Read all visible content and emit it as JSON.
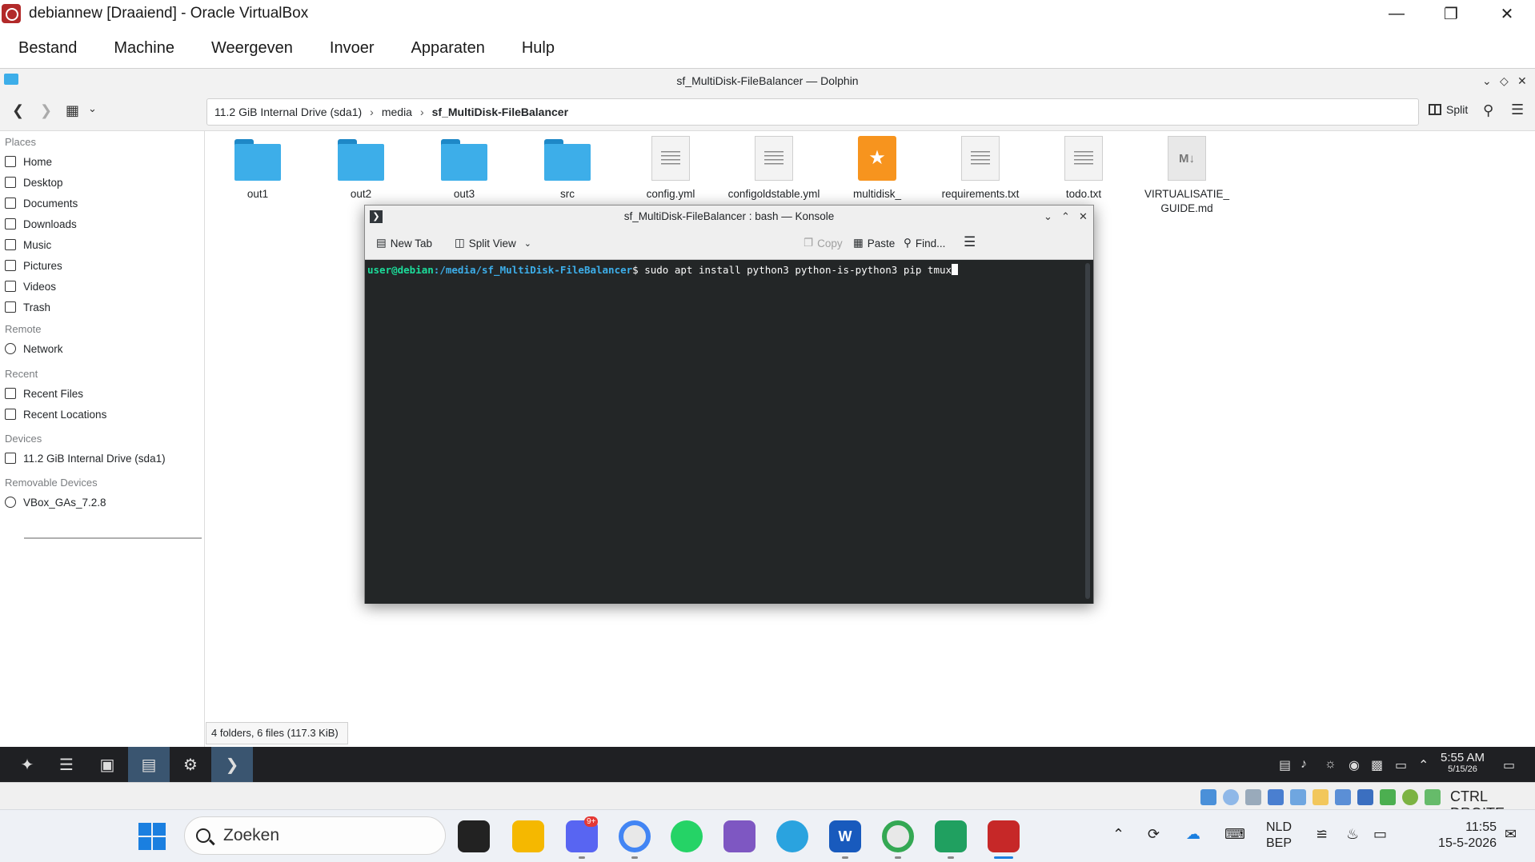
{
  "vbox": {
    "title": "debiannew [Draaiend] - Oracle VirtualBox",
    "menu": [
      "Bestand",
      "Machine",
      "Weergeven",
      "Invoer",
      "Apparaten",
      "Hulp"
    ],
    "host_key": "CTRL DROITE"
  },
  "dolphin": {
    "title": "sf_MultiDisk-FileBalancer — Dolphin",
    "breadcrumb": [
      "11.2 GiB Internal Drive (sda1)",
      "media",
      "sf_MultiDisk-FileBalancer"
    ],
    "split_label": "Split",
    "sidebar": {
      "places_header": "Places",
      "places": [
        "Home",
        "Desktop",
        "Documents",
        "Downloads",
        "Music",
        "Pictures",
        "Videos",
        "Trash"
      ],
      "remote_header": "Remote",
      "remote": [
        "Network"
      ],
      "recent_header": "Recent",
      "recent": [
        "Recent Files",
        "Recent Locations"
      ],
      "devices_header": "Devices",
      "devices": [
        "11.2 GiB Internal Drive (sda1)"
      ],
      "removable_header": "Removable Devices",
      "removable": [
        "VBox_GAs_7.2.8"
      ]
    },
    "files": [
      {
        "name": "out1",
        "kind": "folder"
      },
      {
        "name": "out2",
        "kind": "folder"
      },
      {
        "name": "out3",
        "kind": "folder"
      },
      {
        "name": "src",
        "kind": "folder"
      },
      {
        "name": "config.yml",
        "kind": "text"
      },
      {
        "name": "configoldstable.yml",
        "kind": "text"
      },
      {
        "name": "multidisk_",
        "kind": "python"
      },
      {
        "name": "requirements.txt",
        "kind": "text"
      },
      {
        "name": "todo.txt",
        "kind": "text"
      },
      {
        "name": "VIRTUALISATIE_\nGUIDE.md",
        "kind": "markdown"
      }
    ],
    "status": "4 folders, 6 files (117.3 KiB)"
  },
  "konsole": {
    "title": "sf_MultiDisk-FileBalancer : bash — Konsole",
    "toolbar": {
      "new_tab": "New Tab",
      "split_view": "Split View",
      "copy": "Copy",
      "paste": "Paste",
      "find": "Find..."
    },
    "prompt_user": "user@debian",
    "prompt_path": ":/media/sf_MultiDisk-FileBalancer",
    "prompt_symbol": "$",
    "command": " sudo apt install python3 python-is-python3 pip tmux"
  },
  "guest_panel": {
    "time": "5:55 AM",
    "date": "5/15/26"
  },
  "windows": {
    "search_placeholder": "Zoeken",
    "discord_badge": "9+",
    "lang_top": "NLD",
    "lang_bottom": "BEP",
    "time": "11:55",
    "date": "15-5-2026"
  },
  "colors": {
    "accent": "#3daee9",
    "terminal_bg": "#232627",
    "prompt_user": "#1cdc9a",
    "prompt_path": "#3daee9",
    "vbox_red": "#b22a2a"
  }
}
